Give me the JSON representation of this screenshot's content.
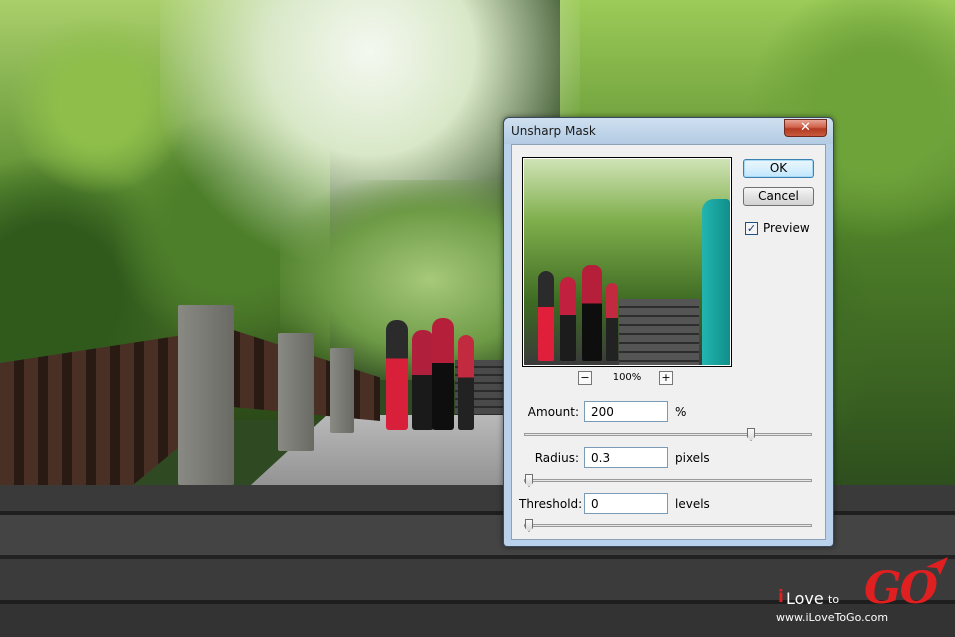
{
  "dialog": {
    "title": "Unsharp Mask",
    "close_symbol": "✕",
    "ok_label": "OK",
    "cancel_label": "Cancel",
    "preview_label": "Preview",
    "preview_checked": true,
    "zoom_out_symbol": "−",
    "zoom_in_symbol": "+",
    "zoom_level": "100%",
    "amount": {
      "label": "Amount:",
      "value": "200",
      "unit": "%",
      "slider_fraction": 0.8
    },
    "radius": {
      "label": "Radius:",
      "value": "0.3",
      "unit": "pixels",
      "slider_fraction": 0.0
    },
    "threshold": {
      "label": "Threshold:",
      "value": "0",
      "unit": "levels",
      "slider_fraction": 0.0
    }
  },
  "watermark": {
    "brand_i": "i",
    "brand_love": "Love",
    "brand_to": "to",
    "brand_go": "GO",
    "url": "www.iLoveToGo.com"
  },
  "colors": {
    "dialog_frame": "#b9d1ea",
    "close_button": "#c75a3e",
    "brand_red": "#e02020"
  }
}
